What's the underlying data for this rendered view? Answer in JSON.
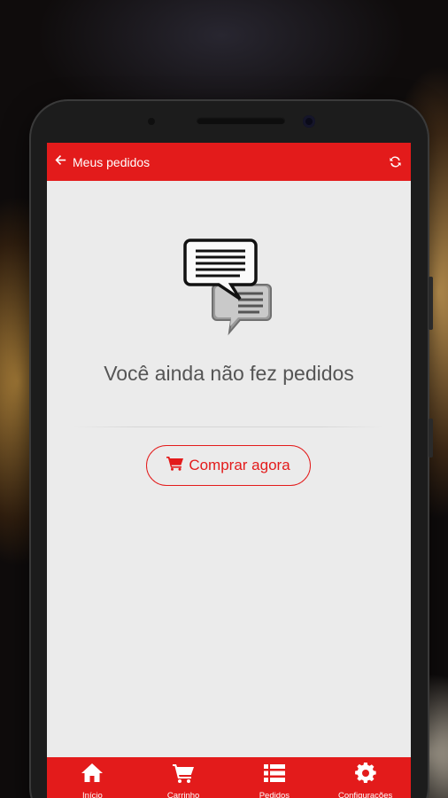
{
  "header": {
    "title": "Meus pedidos"
  },
  "empty_state": {
    "message": "Você ainda não fez pedidos",
    "button_label": "Comprar agora"
  },
  "bottom_nav": {
    "items": [
      {
        "label": "Início",
        "icon": "home-icon"
      },
      {
        "label": "Carrinho",
        "icon": "cart-icon"
      },
      {
        "label": "Pedidos",
        "icon": "list-icon"
      },
      {
        "label": "Configurações",
        "icon": "gear-icon"
      }
    ]
  },
  "colors": {
    "accent": "#e31b1b",
    "screen_background": "#ebebeb",
    "text_muted": "#555555"
  }
}
